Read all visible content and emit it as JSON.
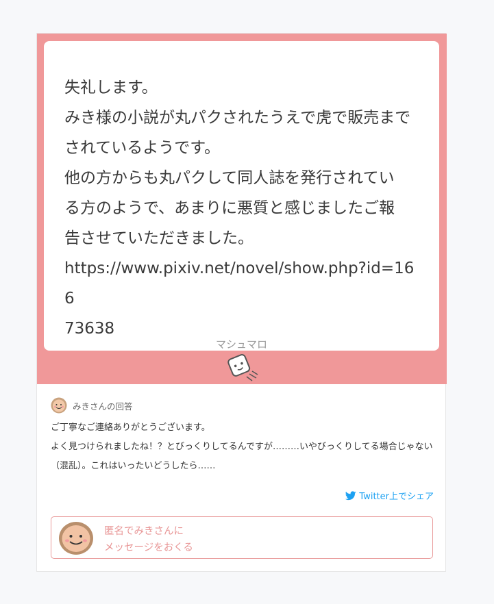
{
  "message": {
    "text": "失礼します。\nみき様の小説が丸パクされたうえで虎で販売まで\nされているようです。\n他の方からも丸パクして同人誌を発行されてい\nる方のようで、あまりに悪質と感じましたご報\n告させていただきました。\nhttps://www.pixiv.net/novel/show.php?id=166\n73638"
  },
  "brand": {
    "label": "マシュマロ",
    "mascot_icon": "marshmallow-mascot-icon"
  },
  "answer": {
    "title": "みきさんの回答",
    "text": "ご丁寧なご連絡ありがとうございます。\nよく見つけられましたね！？とびっくりしてるんですが………いやびっくりしてる場合じゃない\n（混乱）。これはいったいどうしたら……"
  },
  "share": {
    "label": "Twitter上でシェア",
    "icon": "twitter-bird-icon"
  },
  "anonymous_message": {
    "line1": "匿名でみきさんに",
    "line2": "メッセージをおくる"
  },
  "colors": {
    "pink": "#f09899",
    "twitter_blue": "#1da1f2",
    "button_text": "#e89696",
    "page_bg": "#f7f8fa"
  }
}
